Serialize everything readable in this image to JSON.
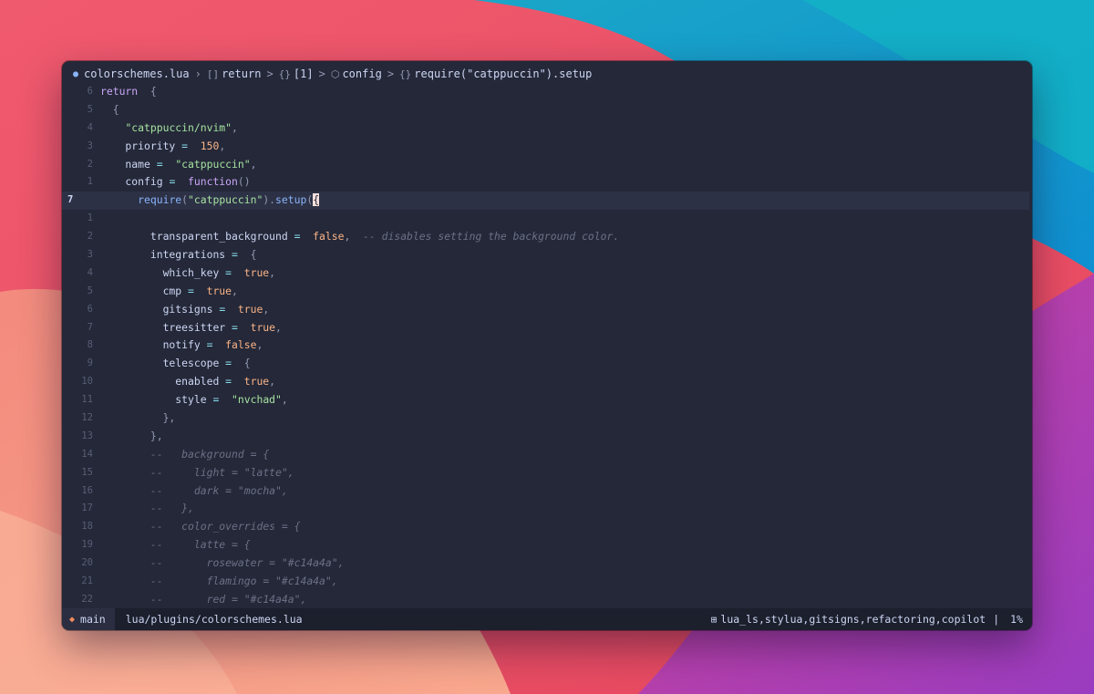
{
  "winbar": {
    "file_icon": "lua-file-icon",
    "file": "colorschemes.lua",
    "crumbs": [
      {
        "icon": "[]",
        "icon_name": "array-icon",
        "text": "return"
      },
      {
        "icon": "{}",
        "icon_name": "object-icon",
        "text": "[1]"
      },
      {
        "icon": "⬡",
        "icon_name": "cube-icon",
        "text": "config"
      },
      {
        "icon": "{}",
        "icon_name": "object-icon",
        "text": "require(\"catppuccin\").setup"
      }
    ]
  },
  "lines": [
    {
      "n": "6",
      "current": false,
      "tokens": [
        [
          "kw",
          "return"
        ],
        [
          "",
          "  "
        ],
        [
          "pun",
          "{"
        ]
      ]
    },
    {
      "n": "5",
      "current": false,
      "tokens": [
        [
          "",
          "  "
        ],
        [
          "pun",
          "{"
        ]
      ]
    },
    {
      "n": "4",
      "current": false,
      "tokens": [
        [
          "",
          "    "
        ],
        [
          "str",
          "\"catppuccin/nvim\""
        ],
        [
          "pun",
          ","
        ]
      ]
    },
    {
      "n": "3",
      "current": false,
      "tokens": [
        [
          "",
          "    priority "
        ],
        [
          "op",
          "="
        ],
        [
          "",
          "  "
        ],
        [
          "num",
          "150"
        ],
        [
          "pun",
          ","
        ]
      ]
    },
    {
      "n": "2",
      "current": false,
      "tokens": [
        [
          "",
          "    name "
        ],
        [
          "op",
          "="
        ],
        [
          "",
          "  "
        ],
        [
          "str",
          "\"catppuccin\""
        ],
        [
          "pun",
          ","
        ]
      ]
    },
    {
      "n": "1",
      "current": false,
      "tokens": [
        [
          "",
          "    config "
        ],
        [
          "op",
          "="
        ],
        [
          "",
          "  "
        ],
        [
          "kw",
          "function"
        ],
        [
          "pun",
          "()"
        ]
      ]
    },
    {
      "n": "7",
      "current": true,
      "tokens": [
        [
          "",
          "      "
        ],
        [
          "fn",
          "require"
        ],
        [
          "pun",
          "("
        ],
        [
          "str",
          "\"catppuccin\""
        ],
        [
          "pun",
          ")."
        ],
        [
          "fn",
          "setup"
        ],
        [
          "pun",
          "("
        ],
        [
          "cursor",
          "{"
        ]
      ]
    },
    {
      "n": "1",
      "current": false,
      "tokens": []
    },
    {
      "n": "2",
      "current": false,
      "tokens": [
        [
          "",
          "        transparent_background "
        ],
        [
          "op",
          "="
        ],
        [
          "",
          "  "
        ],
        [
          "bool",
          "false"
        ],
        [
          "pun",
          ","
        ],
        [
          "",
          "  "
        ],
        [
          "cmt",
          "-- disables setting the background color."
        ]
      ]
    },
    {
      "n": "3",
      "current": false,
      "tokens": [
        [
          "",
          "        integrations "
        ],
        [
          "op",
          "="
        ],
        [
          "",
          "  "
        ],
        [
          "pun",
          "{"
        ]
      ]
    },
    {
      "n": "4",
      "current": false,
      "tokens": [
        [
          "",
          "          which_key "
        ],
        [
          "op",
          "="
        ],
        [
          "",
          "  "
        ],
        [
          "bool",
          "true"
        ],
        [
          "pun",
          ","
        ]
      ]
    },
    {
      "n": "5",
      "current": false,
      "tokens": [
        [
          "",
          "          cmp "
        ],
        [
          "op",
          "="
        ],
        [
          "",
          "  "
        ],
        [
          "bool",
          "true"
        ],
        [
          "pun",
          ","
        ]
      ]
    },
    {
      "n": "6",
      "current": false,
      "tokens": [
        [
          "",
          "          gitsigns "
        ],
        [
          "op",
          "="
        ],
        [
          "",
          "  "
        ],
        [
          "bool",
          "true"
        ],
        [
          "pun",
          ","
        ]
      ]
    },
    {
      "n": "7",
      "current": false,
      "tokens": [
        [
          "",
          "          treesitter "
        ],
        [
          "op",
          "="
        ],
        [
          "",
          "  "
        ],
        [
          "bool",
          "true"
        ],
        [
          "pun",
          ","
        ]
      ]
    },
    {
      "n": "8",
      "current": false,
      "tokens": [
        [
          "",
          "          notify "
        ],
        [
          "op",
          "="
        ],
        [
          "",
          "  "
        ],
        [
          "bool",
          "false"
        ],
        [
          "pun",
          ","
        ]
      ]
    },
    {
      "n": "9",
      "current": false,
      "tokens": [
        [
          "",
          "          telescope "
        ],
        [
          "op",
          "="
        ],
        [
          "",
          "  "
        ],
        [
          "pun",
          "{"
        ]
      ]
    },
    {
      "n": "10",
      "current": false,
      "tokens": [
        [
          "",
          "            enabled "
        ],
        [
          "op",
          "="
        ],
        [
          "",
          "  "
        ],
        [
          "bool",
          "true"
        ],
        [
          "pun",
          ","
        ]
      ]
    },
    {
      "n": "11",
      "current": false,
      "tokens": [
        [
          "",
          "            style "
        ],
        [
          "op",
          "="
        ],
        [
          "",
          "  "
        ],
        [
          "str",
          "\"nvchad\""
        ],
        [
          "pun",
          ","
        ]
      ]
    },
    {
      "n": "12",
      "current": false,
      "tokens": [
        [
          "",
          "          "
        ],
        [
          "pun",
          "},"
        ]
      ]
    },
    {
      "n": "13",
      "current": false,
      "tokens": [
        [
          "",
          "        "
        ],
        [
          "pun",
          "},"
        ]
      ]
    },
    {
      "n": "14",
      "current": false,
      "tokens": [
        [
          "",
          "        "
        ],
        [
          "cmt",
          "--   background = {"
        ]
      ]
    },
    {
      "n": "15",
      "current": false,
      "tokens": [
        [
          "",
          "        "
        ],
        [
          "cmt",
          "--     light = \"latte\","
        ]
      ]
    },
    {
      "n": "16",
      "current": false,
      "tokens": [
        [
          "",
          "        "
        ],
        [
          "cmt",
          "--     dark = \"mocha\","
        ]
      ]
    },
    {
      "n": "17",
      "current": false,
      "tokens": [
        [
          "",
          "        "
        ],
        [
          "cmt",
          "--   },"
        ]
      ]
    },
    {
      "n": "18",
      "current": false,
      "tokens": [
        [
          "",
          "        "
        ],
        [
          "cmt",
          "--   color_overrides = {"
        ]
      ]
    },
    {
      "n": "19",
      "current": false,
      "tokens": [
        [
          "",
          "        "
        ],
        [
          "cmt",
          "--     latte = {"
        ]
      ]
    },
    {
      "n": "20",
      "current": false,
      "tokens": [
        [
          "",
          "        "
        ],
        [
          "cmt",
          "--       rosewater = \"#c14a4a\","
        ]
      ]
    },
    {
      "n": "21",
      "current": false,
      "tokens": [
        [
          "",
          "        "
        ],
        [
          "cmt",
          "--       flamingo = \"#c14a4a\","
        ]
      ]
    },
    {
      "n": "22",
      "current": false,
      "tokens": [
        [
          "",
          "        "
        ],
        [
          "cmt",
          "--       red = \"#c14a4a\","
        ]
      ]
    }
  ],
  "statusline": {
    "branch_icon": "git-branch-icon",
    "branch": "main",
    "path": "lua/plugins/colorschemes.lua",
    "lsp_icon": "lsp-server-icon",
    "lsp": "lua_ls,stylua,gitsigns,refactoring,copilot",
    "separator": "|",
    "progress": "1%"
  },
  "colors": {
    "editor_bg": "#242838",
    "keyword": "#cba6f7",
    "function": "#89b4fa",
    "string": "#a6e3a1",
    "number": "#fab387",
    "comment": "#6c7086"
  }
}
